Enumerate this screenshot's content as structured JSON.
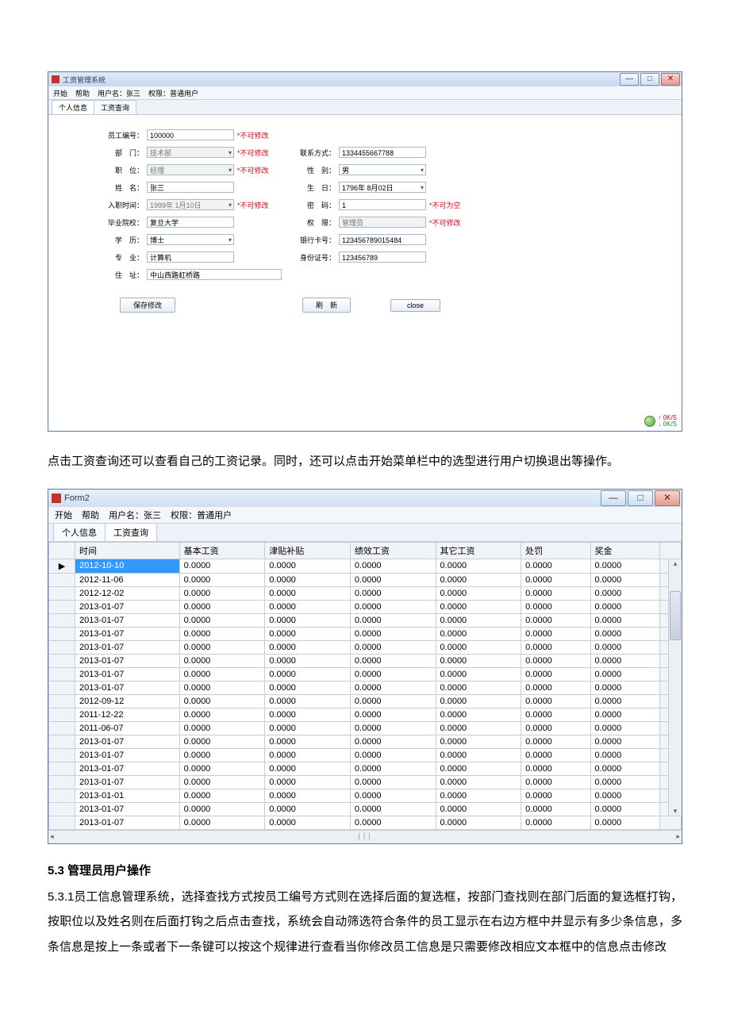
{
  "win1": {
    "title": "工资管理系统",
    "menu": {
      "start": "开始",
      "help": "帮助",
      "user_label": "用户名：张三",
      "role_label": "权限：普通用户"
    },
    "tabs": {
      "personal": "个人信息",
      "salary": "工资查询"
    },
    "form": {
      "emp_id_label": "员工编号：",
      "emp_id": "100000",
      "emp_id_note": "*不可修改",
      "dept_label": "部　门：",
      "dept": "技术部",
      "dept_note": "*不可修改",
      "pos_label": "职　位：",
      "pos": "经理",
      "pos_note": "*不可修改",
      "name_label": "姓　名：",
      "name": "张三",
      "entry_label": "入职时间：",
      "entry": "1999年 1月10日",
      "entry_note": "*不可修改",
      "school_label": "毕业院校：",
      "school": "复旦大学",
      "degree_label": "学　历：",
      "degree": "博士",
      "major_label": "专　业：",
      "major": "计算机",
      "addr_label": "住　址：",
      "addr": "中山西路虹桥路",
      "contact_label": "联系方式：",
      "contact": "1334455667788",
      "gender_label": "性　别：",
      "gender": "男",
      "birth_label": "生　日：",
      "birth": "1796年 8月02日",
      "pwd_label": "密　码：",
      "pwd": "1",
      "pwd_note": "*不可为空",
      "perm_label": "权　限：",
      "perm": "管理员",
      "perm_note": "*不可修改",
      "bank_label": "银行卡号：",
      "bank": "123456789015484",
      "idcard_label": "身份证号：",
      "idcard": "123456789"
    },
    "buttons": {
      "save": "保存修改",
      "refresh": "刷　新",
      "close": "close"
    },
    "footer": {
      "s1": "0K/S",
      "s2": "0K/S"
    }
  },
  "paragraph1": "点击工资查询还可以查看自己的工资记录。同时，还可以点击开始菜单栏中的选型进行用户切换退出等操作。",
  "win2": {
    "title": "Form2",
    "menu": {
      "start": "开始",
      "help": "帮助",
      "user_label": "用户名：张三",
      "role_label": "权限：普通用户"
    },
    "tabs": {
      "personal": "个人信息",
      "salary": "工资查询"
    },
    "columns": [
      "时间",
      "基本工资",
      "津贴补贴",
      "绩效工资",
      "其它工资",
      "处罚",
      "奖金"
    ],
    "rows": [
      [
        "2012-10-10",
        "0.0000",
        "0.0000",
        "0.0000",
        "0.0000",
        "0.0000",
        "0.0000"
      ],
      [
        "2012-11-06",
        "0.0000",
        "0.0000",
        "0.0000",
        "0.0000",
        "0.0000",
        "0.0000"
      ],
      [
        "2012-12-02",
        "0.0000",
        "0.0000",
        "0.0000",
        "0.0000",
        "0.0000",
        "0.0000"
      ],
      [
        "2013-01-07",
        "0.0000",
        "0.0000",
        "0.0000",
        "0.0000",
        "0.0000",
        "0.0000"
      ],
      [
        "2013-01-07",
        "0.0000",
        "0.0000",
        "0.0000",
        "0.0000",
        "0.0000",
        "0.0000"
      ],
      [
        "2013-01-07",
        "0.0000",
        "0.0000",
        "0.0000",
        "0.0000",
        "0.0000",
        "0.0000"
      ],
      [
        "2013-01-07",
        "0.0000",
        "0.0000",
        "0.0000",
        "0.0000",
        "0.0000",
        "0.0000"
      ],
      [
        "2013-01-07",
        "0.0000",
        "0.0000",
        "0.0000",
        "0.0000",
        "0.0000",
        "0.0000"
      ],
      [
        "2013-01-07",
        "0.0000",
        "0.0000",
        "0.0000",
        "0.0000",
        "0.0000",
        "0.0000"
      ],
      [
        "2013-01-07",
        "0.0000",
        "0.0000",
        "0.0000",
        "0.0000",
        "0.0000",
        "0.0000"
      ],
      [
        "2012-09-12",
        "0.0000",
        "0.0000",
        "0.0000",
        "0.0000",
        "0.0000",
        "0.0000"
      ],
      [
        "2011-12-22",
        "0.0000",
        "0.0000",
        "0.0000",
        "0.0000",
        "0.0000",
        "0.0000"
      ],
      [
        "2011-06-07",
        "0.0000",
        "0.0000",
        "0.0000",
        "0.0000",
        "0.0000",
        "0.0000"
      ],
      [
        "2013-01-07",
        "0.0000",
        "0.0000",
        "0.0000",
        "0.0000",
        "0.0000",
        "0.0000"
      ],
      [
        "2013-01-07",
        "0.0000",
        "0.0000",
        "0.0000",
        "0.0000",
        "0.0000",
        "0.0000"
      ],
      [
        "2013-01-07",
        "0.0000",
        "0.0000",
        "0.0000",
        "0.0000",
        "0.0000",
        "0.0000"
      ],
      [
        "2013-01-07",
        "0.0000",
        "0.0000",
        "0.0000",
        "0.0000",
        "0.0000",
        "0.0000"
      ],
      [
        "2013-01-01",
        "0.0000",
        "0.0000",
        "0.0000",
        "0.0000",
        "0.0000",
        "0.0000"
      ],
      [
        "2013-01-07",
        "0.0000",
        "0.0000",
        "0.0000",
        "0.0000",
        "0.0000",
        "0.0000"
      ],
      [
        "2013-01-07",
        "0.0000",
        "0.0000",
        "0.0000",
        "0.0000",
        "0.0000",
        "0.0000"
      ]
    ],
    "selected_row": 0
  },
  "section53": {
    "heading": "5.3 管理员用户操作",
    "body": "5.3.1员工信息管理系统，选择查找方式按员工编号方式则在选择后面的复选框，按部门查找则在部门后面的复选框打钩，按职位以及姓名则在后面打钩之后点击查找，系统会自动筛选符合条件的员工显示在右边方框中并显示有多少条信息，多条信息是按上一条或者下一条键可以按这个规律进行查看当你修改员工信息是只需要修改相应文本框中的信息点击修改"
  },
  "icons": {
    "min": "—",
    "max": "□",
    "close": "✕",
    "arrow_up": "▴",
    "arrow_down": "▾",
    "arrow_left": "◂",
    "arrow_right": "▸",
    "row_pointer": "▶"
  }
}
